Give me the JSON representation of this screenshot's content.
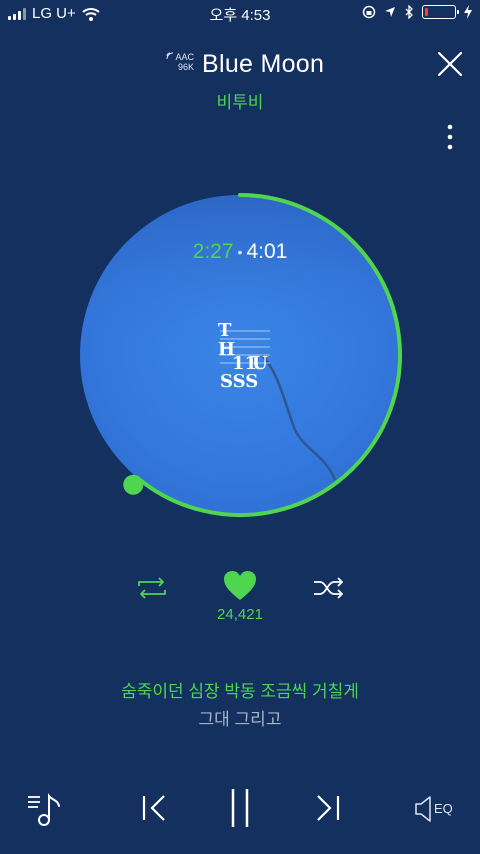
{
  "status_bar": {
    "carrier": "LG U+",
    "time": "오후 4:53",
    "battery_level": 0.12
  },
  "now_playing": {
    "quality_line1": "AAC",
    "quality_line2": "96K",
    "title": "Blue Moon",
    "artist": "비투비",
    "elapsed": "2:27",
    "total": "4:01",
    "progress": 0.61,
    "album_art_text": [
      "T",
      "H",
      "11",
      "U",
      "SSS"
    ]
  },
  "actions": {
    "like_count": "24,421"
  },
  "lyrics": {
    "current": "숨죽이던 심장 박동 조금씩 거칠게",
    "next": "그대 그리고"
  },
  "controls": {
    "eq_label": "EQ"
  },
  "colors": {
    "background": "#13305f",
    "accent": "#4fd550",
    "album": "#3478de"
  }
}
